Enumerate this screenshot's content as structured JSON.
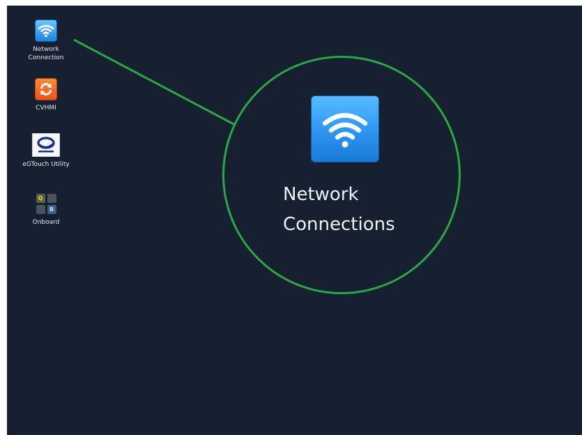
{
  "desktop": {
    "background_color": "#172030",
    "icons": [
      {
        "label": "Network\nConnection",
        "icon": "wifi-icon"
      },
      {
        "label": "CVHMI",
        "icon": "refresh-icon"
      },
      {
        "label": "eGTouch Utility",
        "icon": "egtouch-logo-icon"
      },
      {
        "label": "Onboard",
        "icon": "keyboard-icon",
        "keys": [
          "Q",
          "",
          "",
          "B"
        ]
      }
    ]
  },
  "callout": {
    "label": "Network\nConnections",
    "icon": "wifi-icon",
    "highlight_color": "#29a845"
  }
}
